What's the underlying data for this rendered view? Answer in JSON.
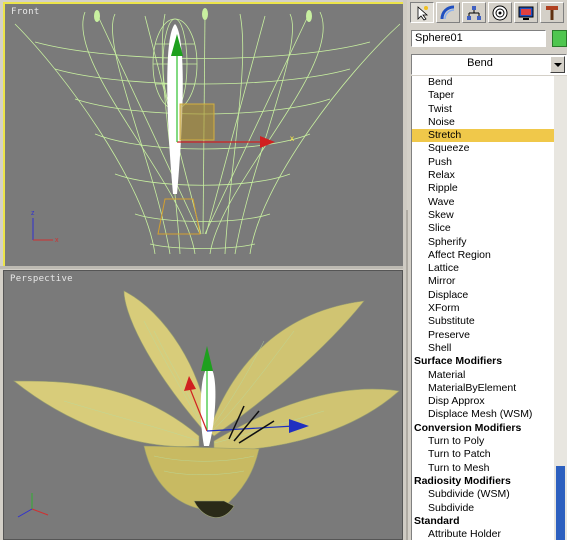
{
  "viewports": {
    "front": {
      "label": "Front"
    },
    "perspective": {
      "label": "Perspective"
    }
  },
  "gizmo": {
    "x_label": "x"
  },
  "command_panel": {
    "tabs": [
      {
        "icon": "create-icon",
        "active": true
      },
      {
        "icon": "modify-icon",
        "active": false
      },
      {
        "icon": "hierarchy-icon",
        "active": false
      },
      {
        "icon": "motion-icon",
        "active": false
      },
      {
        "icon": "display-icon",
        "active": false
      },
      {
        "icon": "utilities-icon",
        "active": false
      }
    ],
    "object_name": "Sphere01",
    "object_color": "#4fc64f",
    "modifier_dropdown": "Bend",
    "modifier_items": [
      {
        "label": "Bend",
        "type": "item"
      },
      {
        "label": "Taper",
        "type": "item"
      },
      {
        "label": "Twist",
        "type": "item"
      },
      {
        "label": "Noise",
        "type": "item"
      },
      {
        "label": "Stretch",
        "type": "item",
        "selected": true
      },
      {
        "label": "Squeeze",
        "type": "item"
      },
      {
        "label": "Push",
        "type": "item"
      },
      {
        "label": "Relax",
        "type": "item"
      },
      {
        "label": "Ripple",
        "type": "item"
      },
      {
        "label": "Wave",
        "type": "item"
      },
      {
        "label": "Skew",
        "type": "item"
      },
      {
        "label": "Slice",
        "type": "item"
      },
      {
        "label": "Spherify",
        "type": "item"
      },
      {
        "label": "Affect Region",
        "type": "item"
      },
      {
        "label": "Lattice",
        "type": "item"
      },
      {
        "label": "Mirror",
        "type": "item"
      },
      {
        "label": "Displace",
        "type": "item"
      },
      {
        "label": "XForm",
        "type": "item"
      },
      {
        "label": "Substitute",
        "type": "item"
      },
      {
        "label": "Preserve",
        "type": "item"
      },
      {
        "label": "Shell",
        "type": "item"
      },
      {
        "label": "Surface Modifiers",
        "type": "section"
      },
      {
        "label": "Material",
        "type": "item"
      },
      {
        "label": "MaterialByElement",
        "type": "item"
      },
      {
        "label": "Disp Approx",
        "type": "item"
      },
      {
        "label": "Displace Mesh (WSM)",
        "type": "item"
      },
      {
        "label": "Conversion Modifiers",
        "type": "section"
      },
      {
        "label": "Turn to Poly",
        "type": "item"
      },
      {
        "label": "Turn to Patch",
        "type": "item"
      },
      {
        "label": "Turn to Mesh",
        "type": "item"
      },
      {
        "label": "Radiosity Modifiers",
        "type": "section"
      },
      {
        "label": "Subdivide (WSM)",
        "type": "item"
      },
      {
        "label": "Subdivide",
        "type": "item"
      },
      {
        "label": "Standard",
        "type": "section"
      },
      {
        "label": "Attribute Holder",
        "type": "item"
      }
    ]
  },
  "colors": {
    "viewport_bg": "#7a7a7a",
    "active_border": "#ece44a",
    "selection": "#f0c84a",
    "wireframe": "#c8f0a0",
    "petal": "#d8cc7a"
  }
}
